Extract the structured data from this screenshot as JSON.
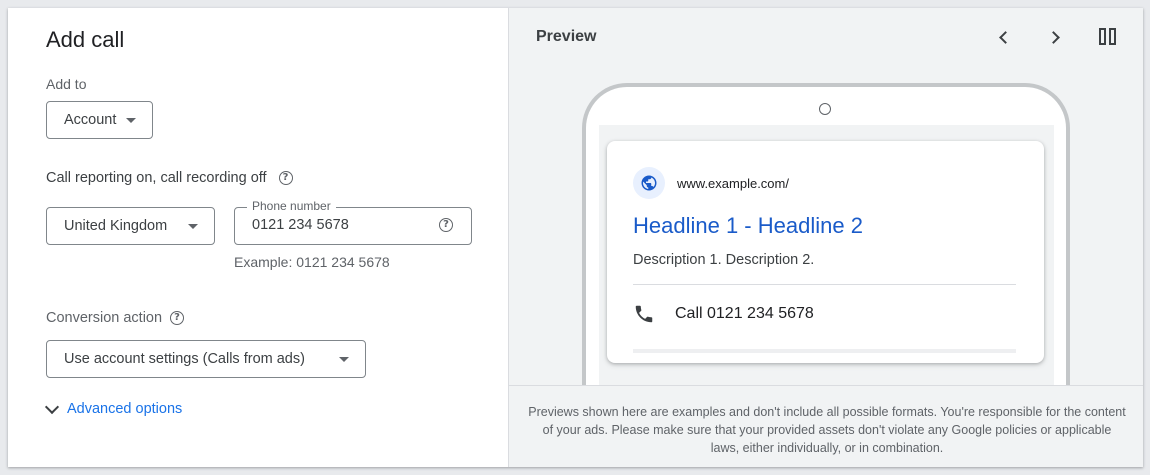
{
  "form": {
    "title": "Add call",
    "add_to_label": "Add to",
    "add_to_value": "Account",
    "call_reporting_label": "Call reporting on, call recording off",
    "country_value": "United Kingdom",
    "phone_label": "Phone number",
    "phone_value": "0121 234 5678",
    "phone_example": "Example: 0121 234 5678",
    "conversion_label": "Conversion action",
    "conversion_value": "Use account settings (Calls from ads)",
    "advanced_label": "Advanced options"
  },
  "preview": {
    "title": "Preview",
    "url": "www.example.com/",
    "headline": "Headline 1 - Headline 2",
    "description": "Description 1. Description 2.",
    "call_text": "Call 0121 234 5678",
    "note": "Previews shown here are examples and don't include all possible formats. You're responsible for the content of your ads. Please make sure that your provided assets don't violate any Google policies or applicable laws, either individually, or in combination."
  },
  "colors": {
    "link": "#1a73e8",
    "headline": "#1a5bc9",
    "panel_bg": "#f1f3f4"
  },
  "icons": [
    "help-icon",
    "caret-down-icon",
    "chevron-down-icon",
    "chevron-left-icon",
    "chevron-right-icon",
    "split-view-icon",
    "globe-icon",
    "phone-icon"
  ]
}
